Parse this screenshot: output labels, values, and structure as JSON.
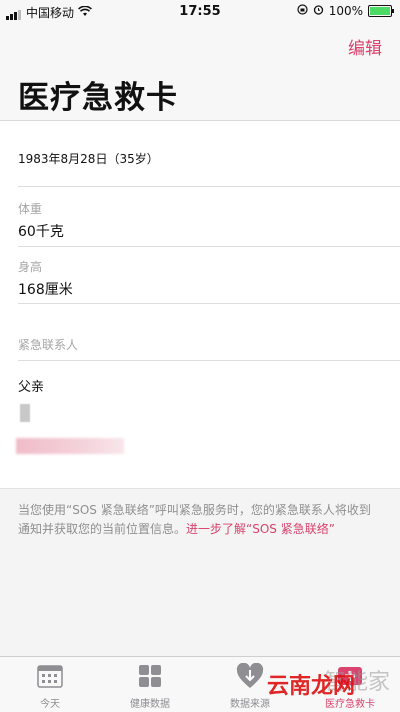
{
  "status": {
    "carrier": "中国移动",
    "time": "17:55",
    "battery": "100%"
  },
  "header": {
    "edit": "编辑",
    "title": "医疗急救卡"
  },
  "birth": "1983年8月28日（35岁）",
  "weight": {
    "label": "体重",
    "value": "60千克"
  },
  "height": {
    "label": "身高",
    "value": "168厘米"
  },
  "contacts": {
    "label": "紧急联系人",
    "name": "父亲"
  },
  "note": {
    "text": "当您使用“SOS 紧急联络”呼叫紧急服务时，您的紧急联系人将收到通知并获取您的当前位置信息。",
    "link": "进一步了解“SOS 紧急联络”"
  },
  "tabs": [
    {
      "label": "今天",
      "icon": "calendar-icon"
    },
    {
      "label": "健康数据",
      "icon": "grid-icon"
    },
    {
      "label": "数据来源",
      "icon": "heart-arrow-icon"
    },
    {
      "label": "医疗急救卡",
      "icon": "medical-id-icon"
    }
  ],
  "watermark": {
    "brand": "智能家",
    "site": "云南龙网"
  },
  "colors": {
    "accent": "#d9436d"
  }
}
